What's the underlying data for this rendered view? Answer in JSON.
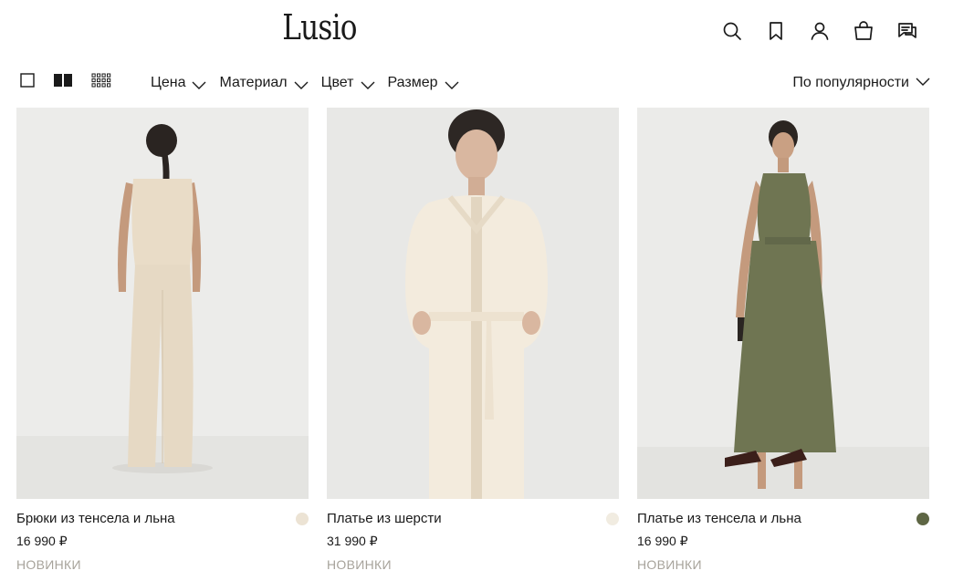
{
  "brand": {
    "logo_text": "Lusio"
  },
  "header": {
    "icons": [
      "search-icon",
      "bookmark-icon",
      "account-icon",
      "bag-icon",
      "chat-icon"
    ]
  },
  "view_modes": [
    "single-column-view-icon",
    "two-column-view-icon",
    "four-column-view-icon"
  ],
  "filters": {
    "price": "Цена",
    "material": "Материал",
    "color": "Цвет",
    "size": "Размер"
  },
  "sort": {
    "label": "По популярности"
  },
  "products": [
    {
      "name": "Брюки из тенсела и льна",
      "price": "16 990 ₽",
      "badge": "НОВИНКИ",
      "swatch_color": "#ece3d4"
    },
    {
      "name": "Платье из шерсти",
      "price": "31 990 ₽",
      "badge": "НОВИНКИ",
      "swatch_color": "#f1ece1"
    },
    {
      "name": "Платье из тенсела и льна",
      "price": "16 990 ₽",
      "badge": "НОВИНКИ",
      "swatch_color": "#5e6644"
    }
  ],
  "colors": {
    "text": "#1a1a1a",
    "muted": "#a7a39b",
    "photo_bg": "#ebebeb",
    "garment_cream": "#eadfcd",
    "garment_olive": "#6f7552"
  }
}
